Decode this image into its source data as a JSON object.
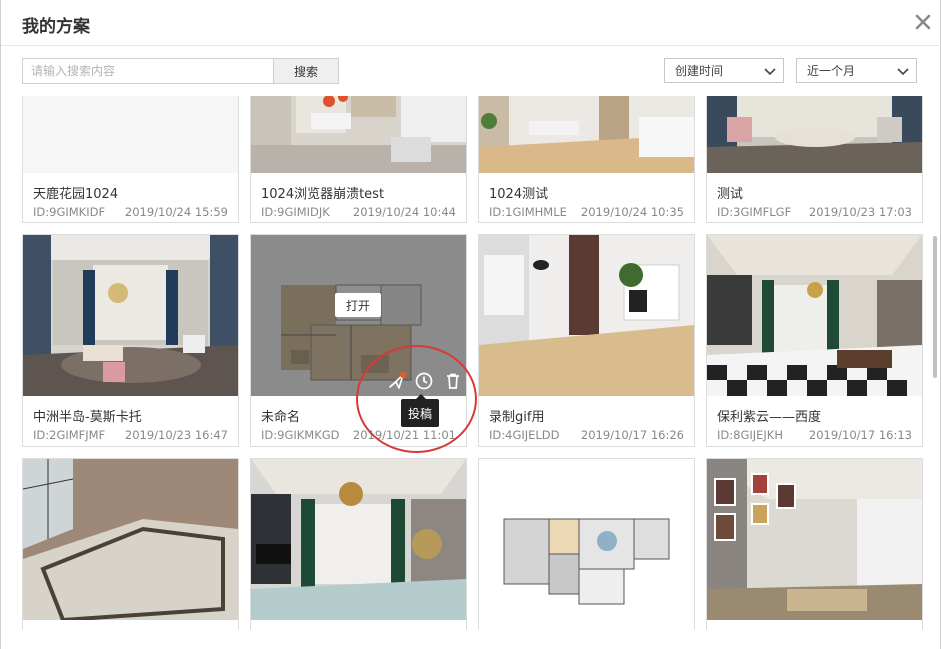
{
  "dialog": {
    "title": "我的方案",
    "close_icon": "close-icon"
  },
  "toolbar": {
    "search_placeholder": "请输入搜索内容",
    "search_value": "",
    "search_label": "搜索",
    "sort_label": "创建时间",
    "range_label": "近一个月"
  },
  "hover": {
    "open_label": "打开",
    "tooltip": "投稿",
    "icons": [
      "publish-icon",
      "history-icon",
      "trash-icon"
    ],
    "badge_color": "#f05a22"
  },
  "annotation": {
    "ring_color": "#d63a3a"
  },
  "cards": [
    {
      "name": "天鹿花园1024",
      "id": "ID:9GIMKIDF",
      "date": "2019/10/24 15:59"
    },
    {
      "name": "1024浏览器崩溃test",
      "id": "ID:9GIMIDJK",
      "date": "2019/10/24 10:44"
    },
    {
      "name": "1024测试",
      "id": "ID:1GIMHMLE",
      "date": "2019/10/24 10:35"
    },
    {
      "name": "测试",
      "id": "ID:3GIMFLGF",
      "date": "2019/10/23 17:03"
    },
    {
      "name": "中洲半岛-莫斯卡托",
      "id": "ID:2GIMFJMF",
      "date": "2019/10/23 16:47"
    },
    {
      "name": "未命名",
      "id": "ID:9GIKMKGD",
      "date": "2019/10/21 11:01"
    },
    {
      "name": "录制gif用",
      "id": "ID:4GIJELDD",
      "date": "2019/10/17 16:26"
    },
    {
      "name": "保利紫云——西度",
      "id": "ID:8GIJEJKH",
      "date": "2019/10/17 16:13"
    },
    {
      "name": "",
      "id": "",
      "date": ""
    },
    {
      "name": "",
      "id": "",
      "date": ""
    },
    {
      "name": "",
      "id": "",
      "date": ""
    },
    {
      "name": "",
      "id": "",
      "date": ""
    }
  ]
}
